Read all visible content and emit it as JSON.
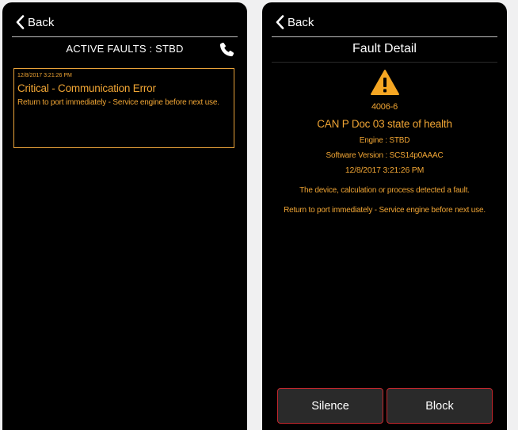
{
  "left": {
    "back_label": "Back",
    "title": "ACTIVE FAULTS : STBD",
    "fault": {
      "timestamp": "12/8/2017 3:21:26 PM",
      "title": "Critical - Communication Error",
      "message": "Return to port immediately - Service engine before next use."
    },
    "icons": {
      "back": "chevron-left-icon",
      "call": "phone-icon"
    }
  },
  "right": {
    "back_label": "Back",
    "title": "Fault Detail",
    "code": "4006-6",
    "name": "CAN P Doc 03 state of health",
    "engine": "Engine : STBD",
    "software": "Software Version : SCS14p0AAAC",
    "timestamp": "12/8/2017 3:21:26 PM",
    "description": "The device, calculation or process detected a fault.",
    "action": "Return to port immediately - Service engine before next use.",
    "buttons": {
      "silence": "Silence",
      "block": "Block"
    },
    "icons": {
      "back": "chevron-left-icon",
      "warning": "warning-triangle-icon"
    }
  },
  "colors": {
    "background": "#000000",
    "accent": "#f0a534",
    "warning_icon": "#f5a623",
    "button_border": "#c2272d",
    "button_bg": "#2a2a2a",
    "text": "#ffffff"
  }
}
